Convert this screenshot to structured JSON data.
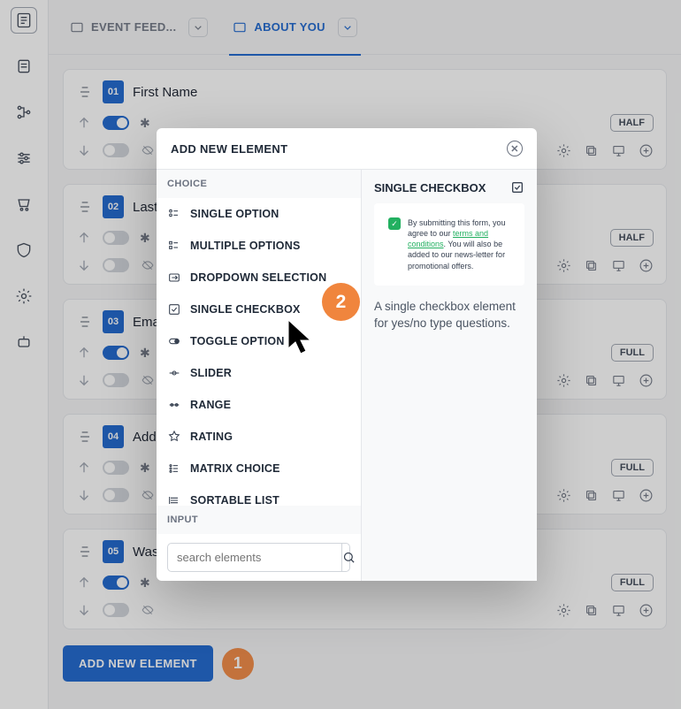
{
  "tabs": [
    {
      "label": "EVENT FEED..."
    },
    {
      "label": "ABOUT YOU"
    }
  ],
  "fields": [
    {
      "num": "01",
      "title": "First Name",
      "pill": "HALF",
      "req": true
    },
    {
      "num": "02",
      "title": "Last N",
      "pill": "HALF",
      "req": false
    },
    {
      "num": "03",
      "title": "Email A",
      "pill": "FULL",
      "req": true
    },
    {
      "num": "04",
      "title": "Addre",
      "pill": "FULL",
      "req": false
    },
    {
      "num": "05",
      "title": "Was th",
      "pill": "FULL",
      "req": true
    }
  ],
  "addBtn": "ADD NEW ELEMENT",
  "annot": {
    "btn": "1",
    "opt": "2"
  },
  "modal": {
    "title": "ADD NEW ELEMENT",
    "sections": {
      "choice": "CHOICE",
      "input": "INPUT"
    },
    "options": [
      "SINGLE OPTION",
      "MULTIPLE OPTIONS",
      "DROPDOWN SELECTION",
      "SINGLE CHECKBOX",
      "TOGGLE OPTION",
      "SLIDER",
      "RANGE",
      "RATING",
      "MATRIX CHOICE",
      "SORTABLE LIST"
    ],
    "searchPlaceholder": "search elements",
    "preview": {
      "title": "SINGLE CHECKBOX",
      "text1": "By submitting this form, you agree to our ",
      "link": "terms and conditions",
      "text2": ". You will also be added to our news-letter for promotional offers.",
      "desc": "A single checkbox element for yes/no type questions."
    }
  }
}
